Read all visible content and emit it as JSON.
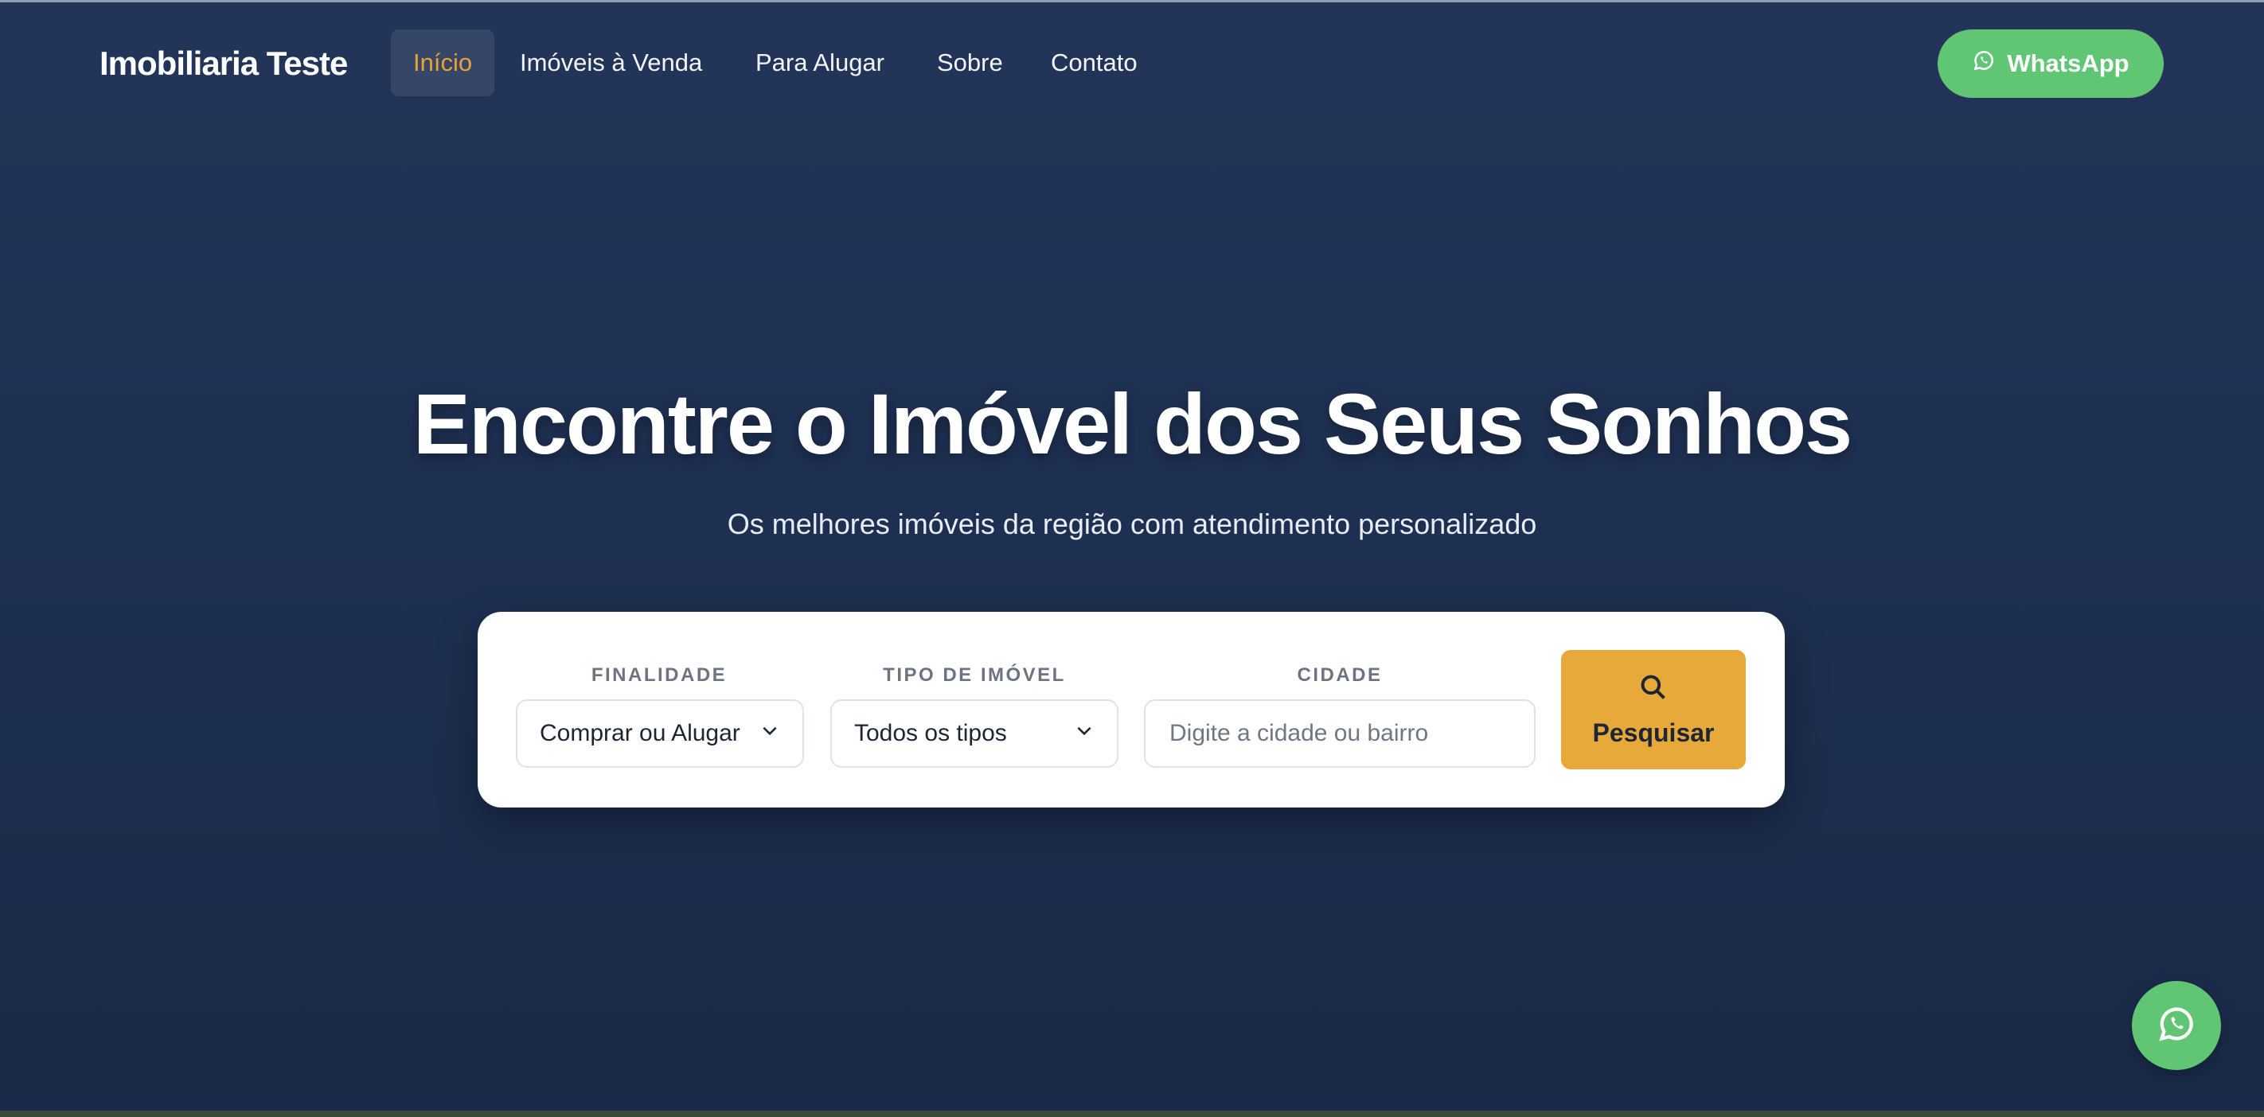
{
  "header": {
    "brand": "Imobiliaria Teste",
    "nav": [
      {
        "label": "Início",
        "active": true
      },
      {
        "label": "Imóveis à Venda",
        "active": false
      },
      {
        "label": "Para Alugar",
        "active": false
      },
      {
        "label": "Sobre",
        "active": false
      },
      {
        "label": "Contato",
        "active": false
      }
    ],
    "whatsapp_label": "WhatsApp",
    "whatsapp_icon": "whatsapp-icon"
  },
  "hero": {
    "title": "Encontre o Imóvel dos Seus Sonhos",
    "subtitle": "Os melhores imóveis da região com atendimento personalizado"
  },
  "search": {
    "finalidade_label": "FINALIDADE",
    "finalidade_value": "Comprar ou Alugar",
    "tipo_label": "TIPO DE IMÓVEL",
    "tipo_value": "Todos os tipos",
    "cidade_label": "CIDADE",
    "cidade_placeholder": "Digite a cidade ou bairro",
    "button_label": "Pesquisar",
    "button_icon": "search-icon"
  },
  "colors": {
    "background": "#1e3052",
    "accent": "#e6a93a",
    "whatsapp": "#61c673"
  }
}
